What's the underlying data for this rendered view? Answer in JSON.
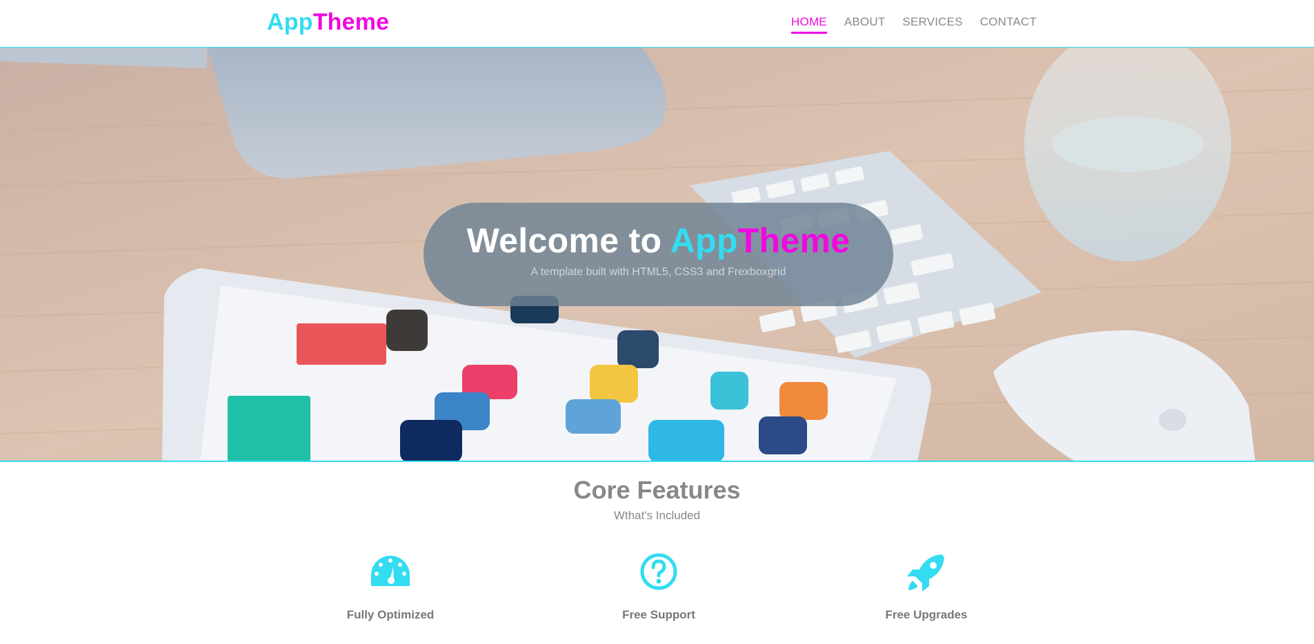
{
  "brand": {
    "part1": "App",
    "part2": "Theme"
  },
  "nav": {
    "items": [
      {
        "label": "HOME",
        "active": true
      },
      {
        "label": "ABOUT",
        "active": false
      },
      {
        "label": "SERVICES",
        "active": false
      },
      {
        "label": "CONTACT",
        "active": false
      }
    ]
  },
  "hero": {
    "title_prefix": "Welcome to ",
    "title_part1": "App",
    "title_part2": "Theme",
    "subtitle": "A template built with HTML5, CSS3 and Frexboxgrid"
  },
  "features": {
    "title": "Core Features",
    "subtitle": "Wthat's Included",
    "items": [
      {
        "label": "Fully Optimized",
        "icon": "dashboard-icon"
      },
      {
        "label": "Free Support",
        "icon": "question-circle-icon"
      },
      {
        "label": "Free Upgrades",
        "icon": "rocket-icon"
      }
    ]
  },
  "colors": {
    "cyan": "#33dcf0",
    "magenta": "#f008e0",
    "text": "#777777"
  }
}
